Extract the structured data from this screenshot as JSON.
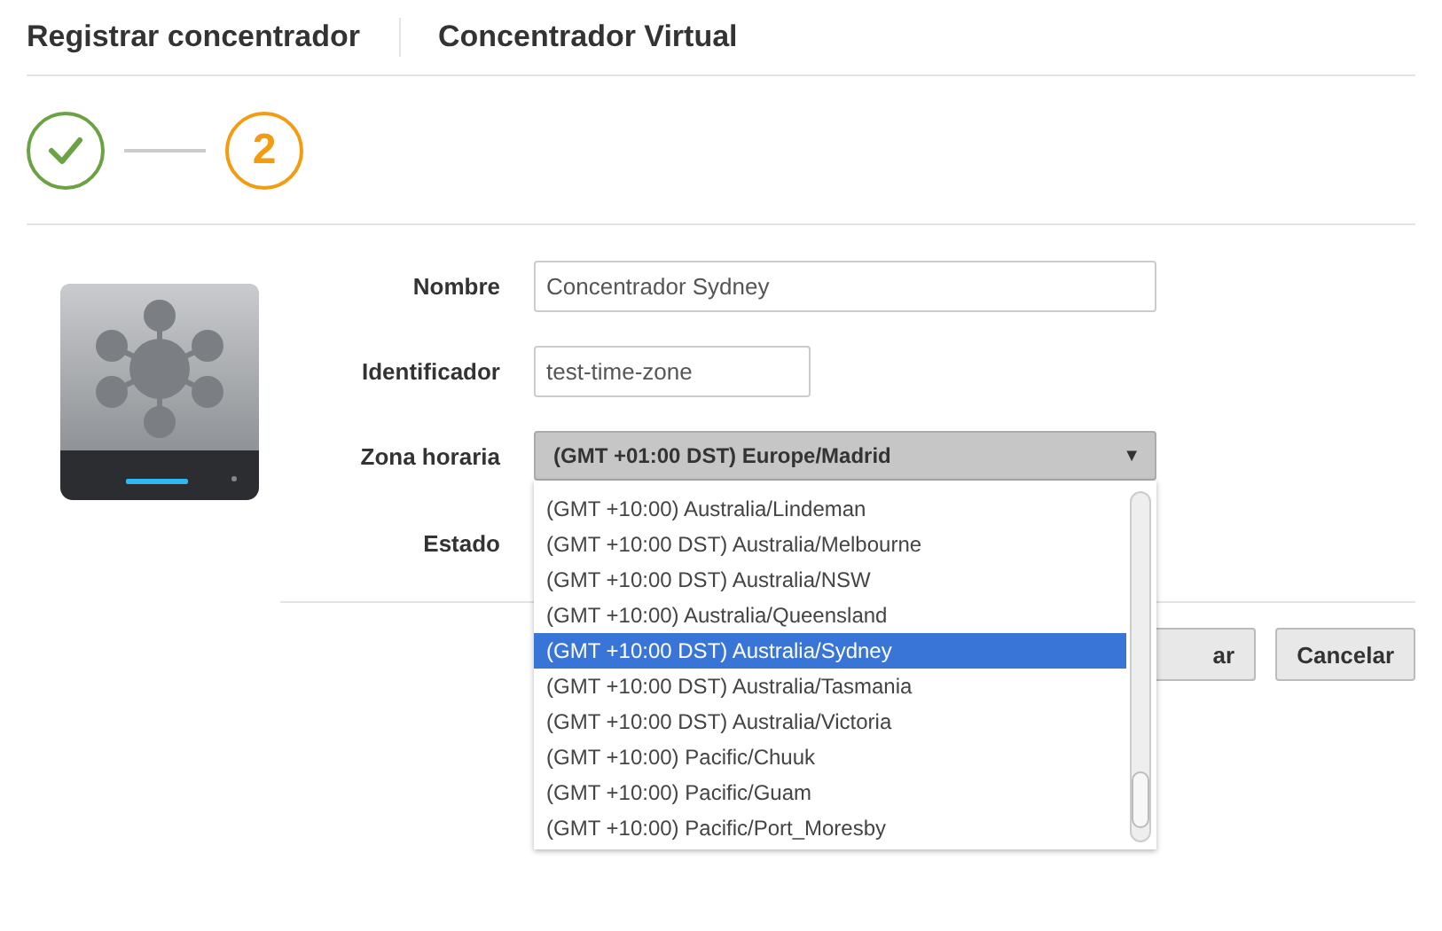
{
  "header": {
    "title": "Registrar concentrador",
    "subtitle": "Concentrador Virtual"
  },
  "steps": [
    {
      "kind": "done"
    },
    {
      "kind": "current",
      "label": "2"
    }
  ],
  "form": {
    "fields": [
      {
        "label": "Nombre",
        "kind": "text",
        "value": "Concentrador Sydney"
      },
      {
        "label": "Identificador",
        "kind": "short",
        "value": "test-time-zone"
      },
      {
        "label": "Zona horaria",
        "kind": "select",
        "value": "(GMT +01:00 DST) Europe/Madrid",
        "arrow": "▼",
        "options": [
          {
            "label": "(GMT +10:00) Australia/Lindeman",
            "selected": false
          },
          {
            "label": "(GMT +10:00 DST) Australia/Melbourne",
            "selected": false
          },
          {
            "label": "(GMT +10:00 DST) Australia/NSW",
            "selected": false
          },
          {
            "label": "(GMT +10:00) Australia/Queensland",
            "selected": false
          },
          {
            "label": "(GMT +10:00 DST) Australia/Sydney",
            "selected": true
          },
          {
            "label": "(GMT +10:00 DST) Australia/Tasmania",
            "selected": false
          },
          {
            "label": "(GMT +10:00 DST) Australia/Victoria",
            "selected": false
          },
          {
            "label": "(GMT +10:00) Pacific/Chuuk",
            "selected": false
          },
          {
            "label": "(GMT +10:00) Pacific/Guam",
            "selected": false
          },
          {
            "label": "(GMT +10:00) Pacific/Port_Moresby",
            "selected": false
          }
        ]
      },
      {
        "label": "Estado",
        "kind": "empty"
      }
    ]
  },
  "buttons": [
    "ar",
    "Cancelar"
  ]
}
